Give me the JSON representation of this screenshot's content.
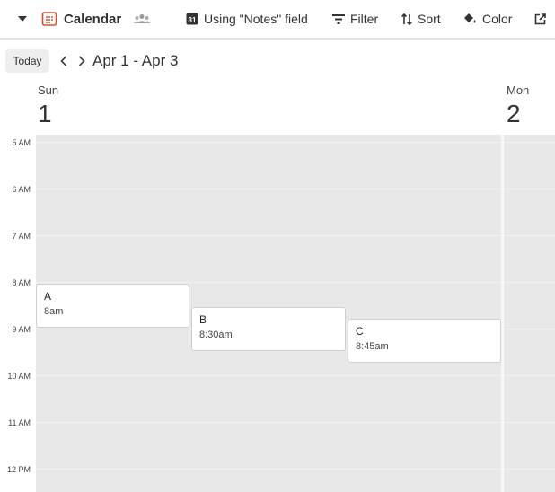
{
  "toolbar": {
    "view_name": "Calendar",
    "date_field": "Using \"Notes\" field",
    "filter": "Filter",
    "sort": "Sort",
    "color": "Color",
    "calendar_icon_digit": "31"
  },
  "nav": {
    "today": "Today",
    "range": "Apr 1 - Apr 3"
  },
  "days": [
    {
      "name": "Sun",
      "number": "1"
    },
    {
      "name": "Mon",
      "number": "2"
    }
  ],
  "time_labels": [
    "5 AM",
    "6 AM",
    "7 AM",
    "8 AM",
    "9 AM",
    "10 AM",
    "11 AM",
    "12 PM"
  ],
  "events": [
    {
      "title": "A",
      "time": "8am"
    },
    {
      "title": "B",
      "time": "8:30am"
    },
    {
      "title": "C",
      "time": "8:45am"
    }
  ],
  "colors": {
    "accent": "#d54f2c",
    "grid_bg": "#e8e8e8",
    "event_bg": "#ffffff"
  }
}
